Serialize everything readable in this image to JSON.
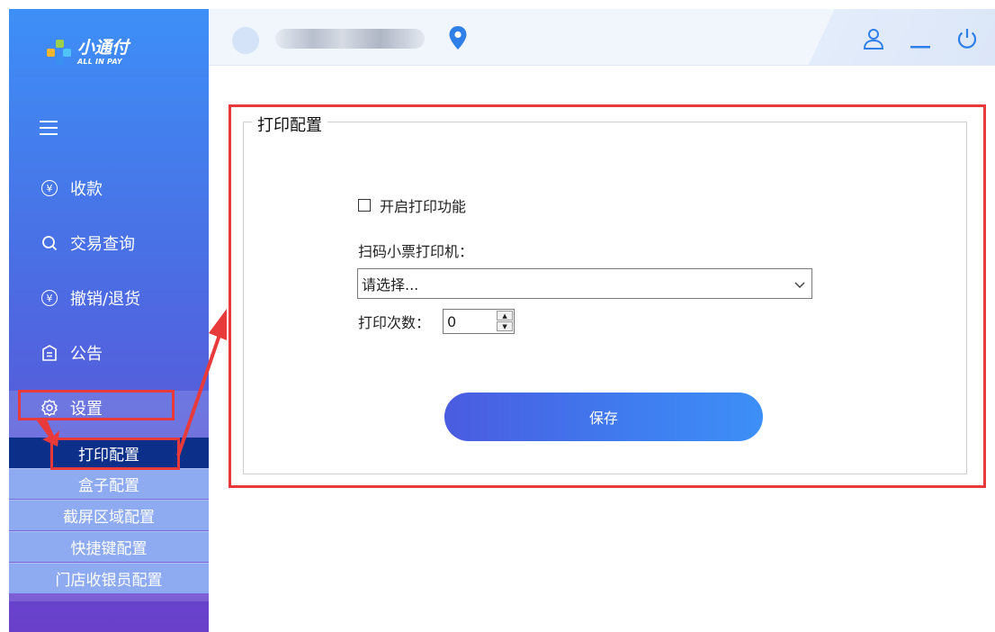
{
  "brand": {
    "name_cn": "小通付",
    "name_en": "ALL IN PAY",
    "accent": "#3d8ff7",
    "annotation_color": "#e83a3a"
  },
  "header": {
    "user_avatar_icon": "avatar-circle",
    "location_icon": "location-pin-icon",
    "user_icon": "user-icon",
    "minimize_icon": "minimize-icon",
    "power_icon": "power-icon"
  },
  "sidebar": {
    "menu_icon": "hamburger-icon",
    "items": [
      {
        "label": "收款",
        "icon": "yen-circle-icon"
      },
      {
        "label": "交易查询",
        "icon": "search-icon"
      },
      {
        "label": "撤销/退货",
        "icon": "refund-icon"
      },
      {
        "label": "公告",
        "icon": "notice-icon"
      },
      {
        "label": "设置",
        "icon": "gear-icon"
      }
    ],
    "submenu": [
      {
        "label": "打印配置",
        "active": true
      },
      {
        "label": "盒子配置",
        "active": false
      },
      {
        "label": "截屏区域配置",
        "active": false
      },
      {
        "label": "快捷键配置",
        "active": false
      },
      {
        "label": "门店收银员配置",
        "active": false
      }
    ]
  },
  "print_config": {
    "legend": "打印配置",
    "enable_label": "开启打印功能",
    "enable_checked": false,
    "printer_label": "扫码小票打印机：",
    "printer_selected": "请选择...",
    "count_label": "打印次数：",
    "count_value": "0",
    "save_label": "保存"
  }
}
